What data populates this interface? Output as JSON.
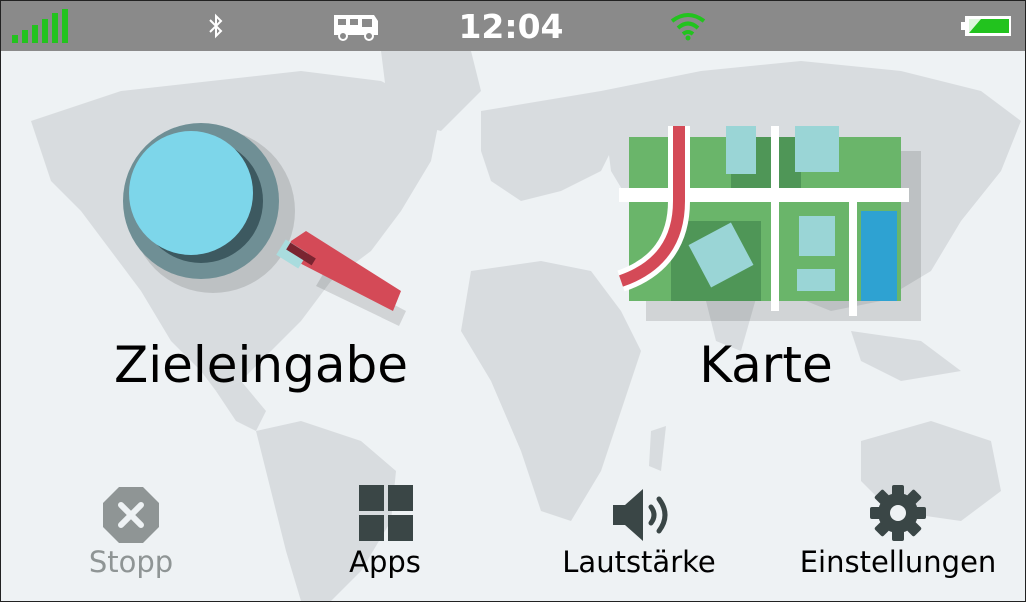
{
  "statusbar": {
    "time": "12:04",
    "signal_color": "#22c31e",
    "wifi_color": "#22c31e",
    "battery_color": "#22c31e",
    "icons": [
      "signal-bars-icon",
      "bluetooth-icon",
      "camper-van-icon",
      "wifi-icon",
      "battery-icon"
    ]
  },
  "main": {
    "tiles": [
      {
        "label": "Zieleingabe",
        "icon": "magnifier-icon"
      },
      {
        "label": "Karte",
        "icon": "map-icon"
      }
    ]
  },
  "bottom_bar": [
    {
      "label": "Stopp",
      "icon": "stop-x-icon",
      "disabled": true
    },
    {
      "label": "Apps",
      "icon": "apps-grid-icon"
    },
    {
      "label": "Lautstärke",
      "icon": "speaker-icon"
    },
    {
      "label": "Einstellungen",
      "icon": "gear-icon"
    }
  ],
  "colors": {
    "background": "#eef2f4",
    "statusbar": "#8a8a8a",
    "icon_dark": "#3a4646",
    "disabled": "#8f9595",
    "magnifier_lens": "#7dd6ea",
    "handle_red": "#d44a57",
    "map_green": "#6ab56a",
    "map_building": "#9ad5d6",
    "map_water": "#2ea2d2"
  }
}
